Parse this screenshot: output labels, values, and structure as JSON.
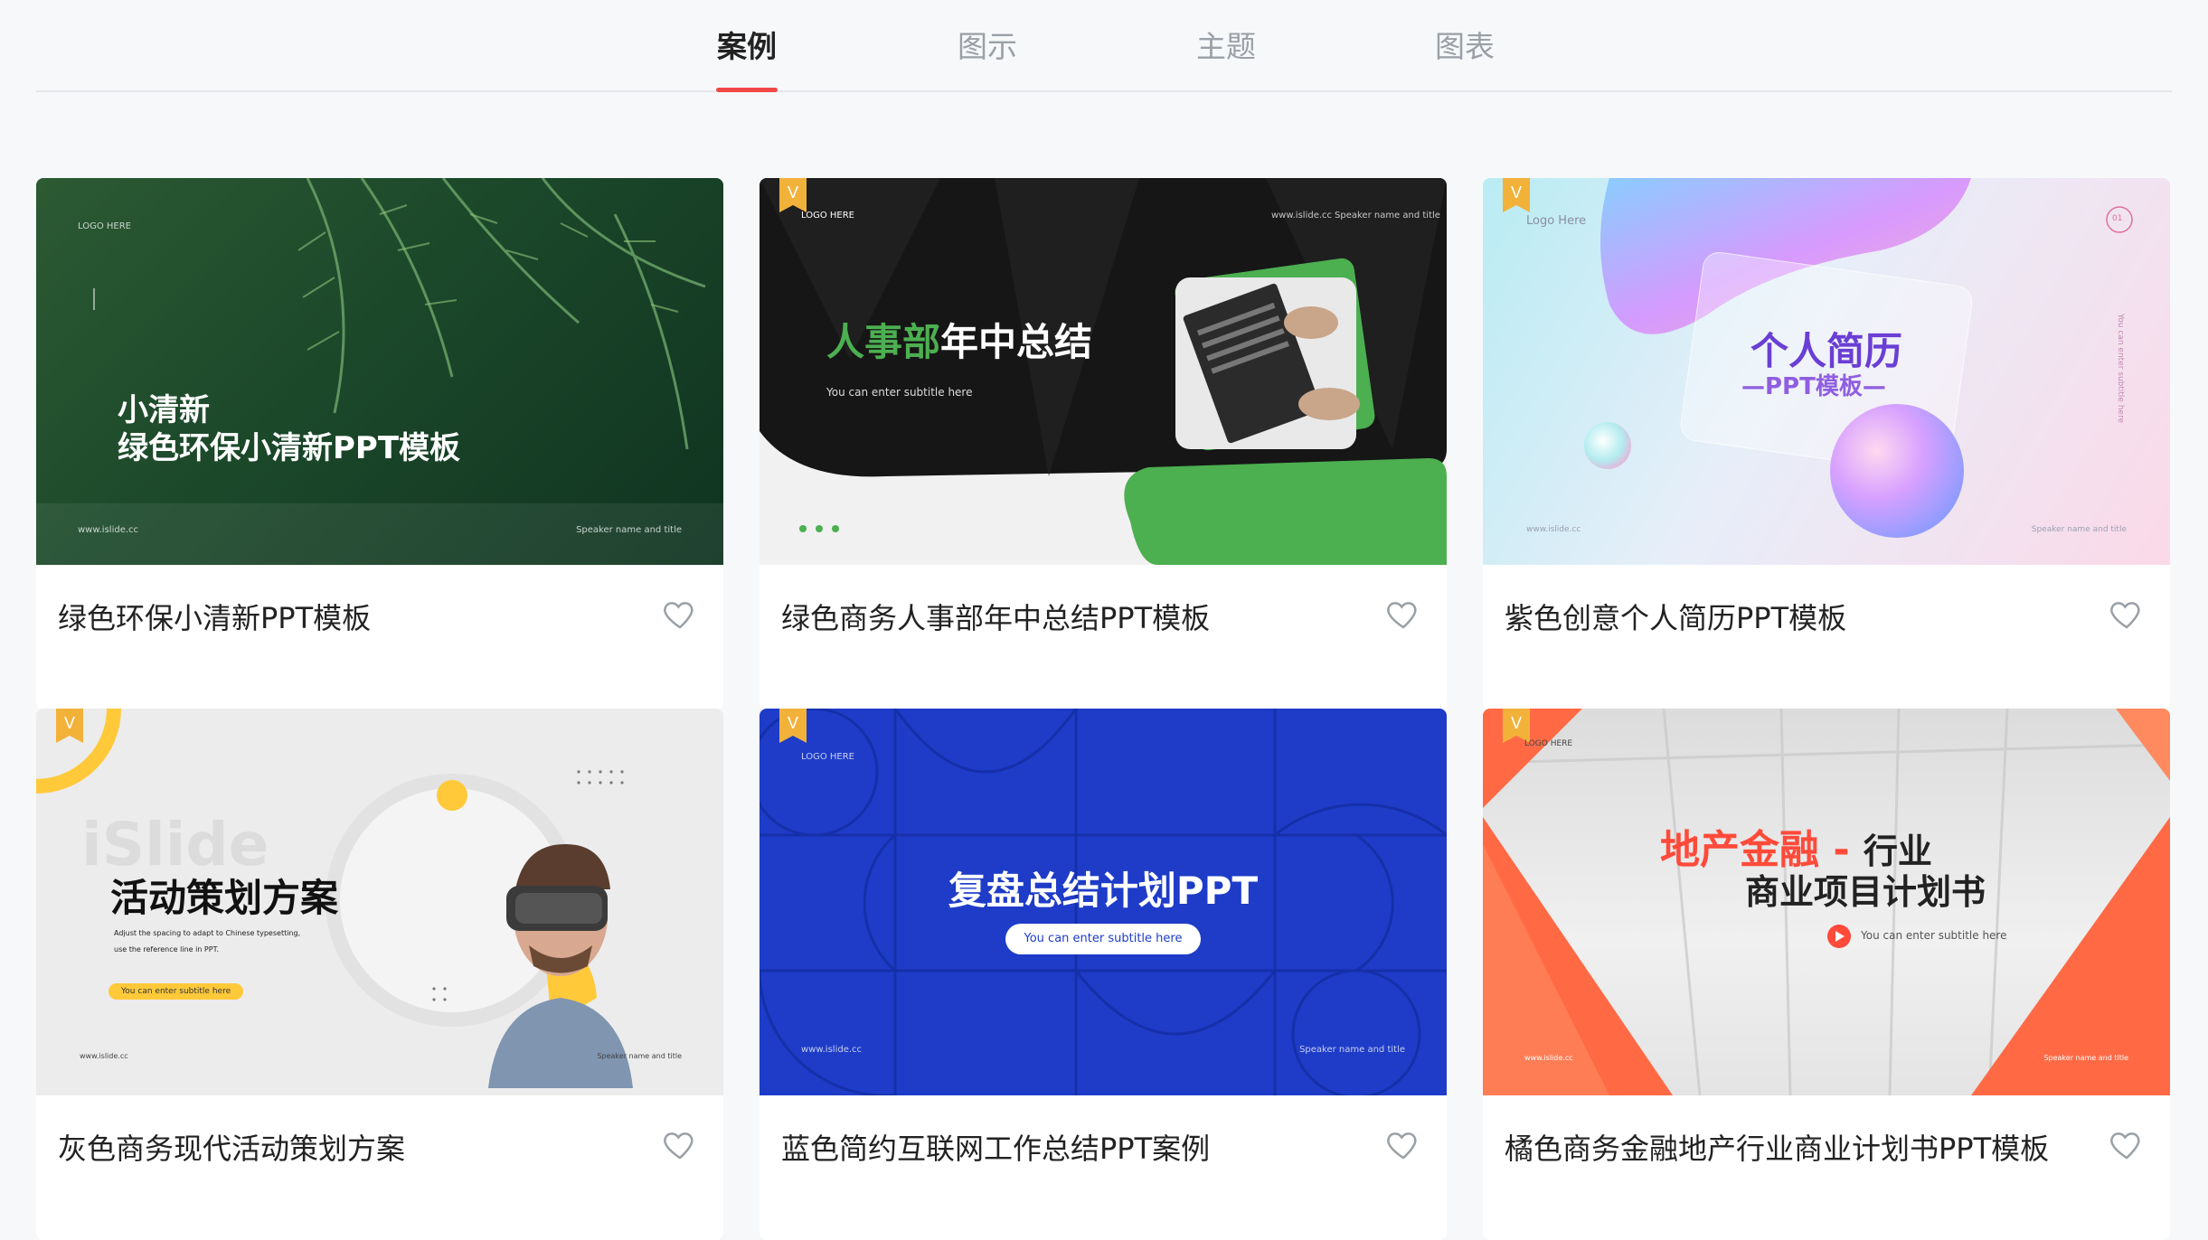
{
  "tabs": [
    {
      "label": "案例",
      "active": true
    },
    {
      "label": "图示",
      "active": false
    },
    {
      "label": "主题",
      "active": false
    },
    {
      "label": "图表",
      "active": false
    }
  ],
  "cards": [
    {
      "title": "绿色环保小清新PPT模板",
      "thumb": {
        "logo": "LOGO HERE",
        "line1": "小清新",
        "line2": "绿色环保小清新PPT模板",
        "site": "www.islide.cc",
        "speaker": "Speaker name and title"
      }
    },
    {
      "title": "绿色商务人事部年中总结PPT模板",
      "thumb": {
        "logo": "LOGO HERE",
        "site": "www.islide.cc",
        "speaker": "Speaker name and title",
        "heading_green": "人事部",
        "heading_white": "年中总结",
        "subtitle": "You can enter subtitle here"
      }
    },
    {
      "title": "紫色创意个人简历PPT模板",
      "thumb": {
        "logo": "Logo Here",
        "num": "01",
        "heading": "个人简历",
        "sub": "—PPT模板—",
        "side": "You can enter subtitle here",
        "site": "www.islide.cc",
        "speaker": "Speaker name and title"
      }
    },
    {
      "title": "灰色商务现代活动策划方案",
      "thumb": {
        "watermark": "iSlide",
        "heading": "活动策划方案",
        "desc1": "Adjust the spacing to adapt to Chinese typesetting,",
        "desc2": "use the reference line in PPT.",
        "pill": "You can enter subtitle here",
        "site": "www.islide.cc",
        "speaker": "Speaker name and title"
      }
    },
    {
      "title": "蓝色简约互联网工作总结PPT案例",
      "thumb": {
        "logo": "LOGO HERE",
        "heading": "复盘总结计划PPT",
        "pill": "You can enter subtitle here",
        "site": "www.islide.cc",
        "speaker": "Speaker name and title"
      }
    },
    {
      "title": "橘色商务金融地产行业商业计划书PPT模板",
      "thumb": {
        "logo": "LOGO HERE",
        "heading_orange": "地产金融 -",
        "heading_dark1": "行业",
        "heading_dark2": "商业项目计划书",
        "subtitle": "You can enter subtitle here",
        "site": "www.islide.cc",
        "speaker": "Speaker name and title"
      }
    }
  ],
  "colors": {
    "accent": "#f04848",
    "green": "#4caf50",
    "blue": "#1e3cc8",
    "orange": "#ff6a45"
  }
}
